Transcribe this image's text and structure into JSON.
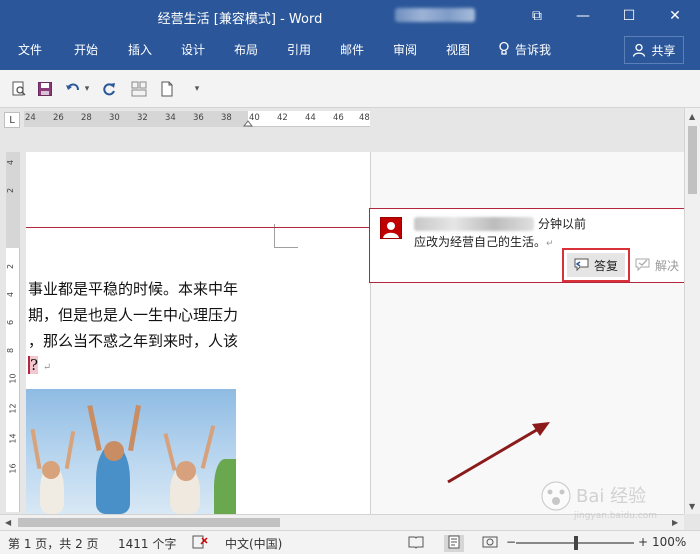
{
  "window": {
    "title": "经营生活 [兼容模式]  -  Word",
    "controls": {
      "restore_ribbon": "⧉",
      "minimize": "—",
      "maximize": "☐",
      "close": "✕"
    }
  },
  "ribbon": {
    "tabs": [
      "文件",
      "开始",
      "插入",
      "设计",
      "布局",
      "引用",
      "邮件",
      "审阅",
      "视图"
    ],
    "tell_me": "告诉我",
    "share": "共享",
    "accent_color": "#2b579a"
  },
  "quick_access": {
    "icons": [
      "print-preview-icon",
      "save-icon",
      "undo-icon",
      "undo-dropdown-icon",
      "redo-icon",
      "layout-icon",
      "new-doc-icon",
      "customize-icon"
    ],
    "undo_dropdown": "▾",
    "customize": "▾"
  },
  "ruler": {
    "corner": "L",
    "ticks": [
      "24",
      "26",
      "28",
      "30",
      "32",
      "34",
      "36",
      "38",
      "40",
      "42",
      "44",
      "46",
      "48"
    ],
    "vticks": [
      "4",
      "2",
      "",
      "2",
      "4",
      "6",
      "8",
      "10",
      "12",
      "14",
      "16"
    ]
  },
  "document": {
    "lines": [
      "事业都是平稳的时候。本来中年",
      "期，但是也是人一生中心理压力",
      "，那么当不惑之年到来时，人该",
      "?"
    ],
    "para_mark": "↵"
  },
  "comment": {
    "time": "分钟以前",
    "text": "应改为经营自己的生活。",
    "para_mark": "↵",
    "reply": "答复",
    "resolve": "解决",
    "highlight_color": "#d9313a"
  },
  "status": {
    "page": "第 1 页，共 2 页",
    "words": "1411 个字",
    "language": "中文(中国)",
    "zoom": "100%",
    "zoom_minus": "−",
    "zoom_plus": "+"
  },
  "watermark": {
    "text": "Bai 经验",
    "sub": "jingyan.baidu.com"
  }
}
